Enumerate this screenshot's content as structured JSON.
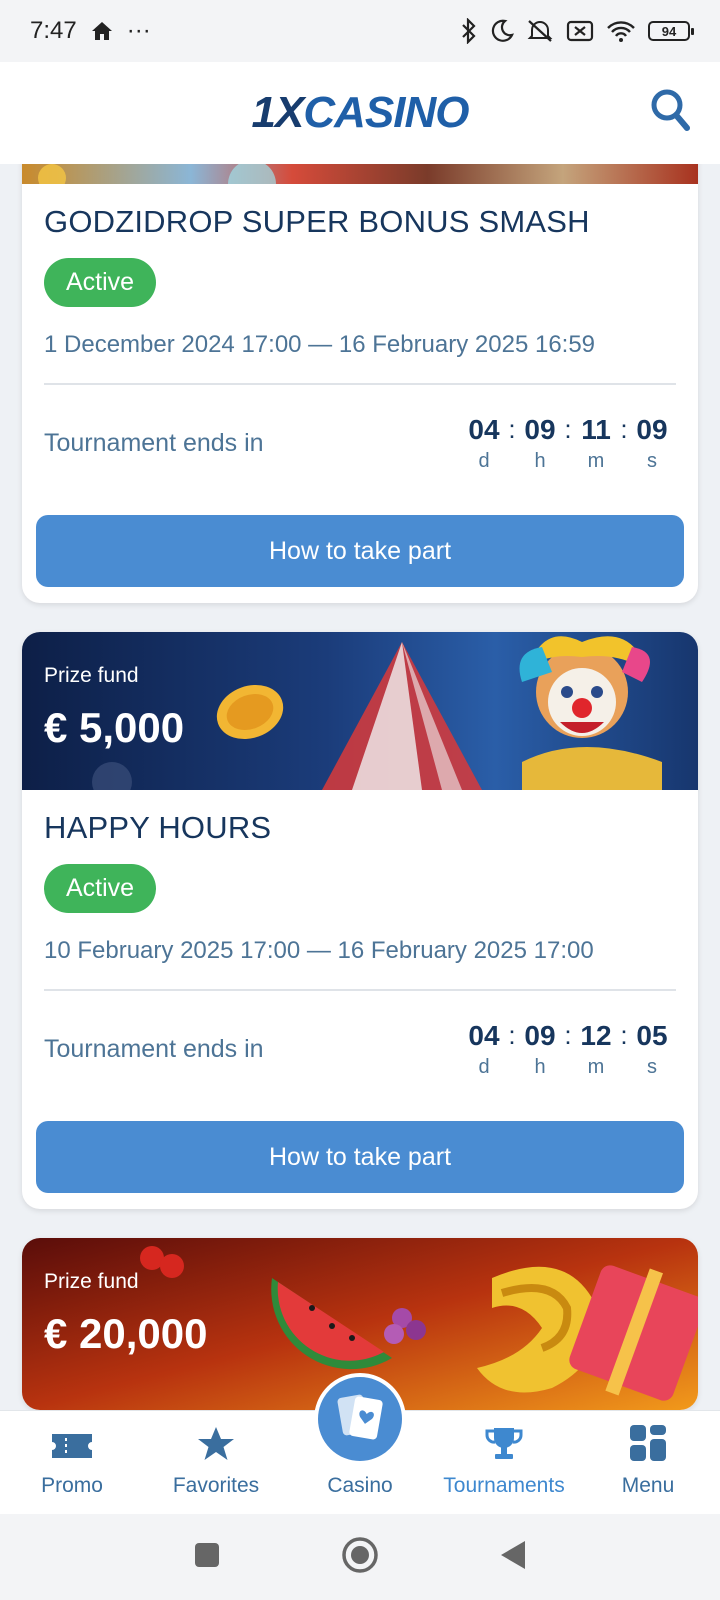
{
  "status_bar": {
    "time": "7:47",
    "more": "···",
    "battery": "94"
  },
  "header": {
    "logo_a": "1X",
    "logo_b": "CASINO"
  },
  "tournaments": [
    {
      "title": "GODZIDROP SUPER BONUS SMASH",
      "status": "Active",
      "dates": "1 December 2024 17:00 — 16 February 2025 16:59",
      "ends_label": "Tournament ends in",
      "timer": {
        "d": "04",
        "h": "09",
        "m": "11",
        "s": "09"
      },
      "button": "How to take part"
    },
    {
      "prize_label": "Prize fund",
      "prize_value": "€ 5,000",
      "title": "HAPPY HOURS",
      "status": "Active",
      "dates": "10 February 2025 17:00 — 16 February 2025 17:00",
      "ends_label": "Tournament ends in",
      "timer": {
        "d": "04",
        "h": "09",
        "m": "12",
        "s": "05"
      },
      "button": "How to take part"
    },
    {
      "prize_label": "Prize fund",
      "prize_value": "€ 20,000"
    }
  ],
  "timer_units": {
    "d": "d",
    "h": "h",
    "m": "m",
    "s": "s"
  },
  "timer_sep": ":",
  "nav": {
    "promo": "Promo",
    "favorites": "Favorites",
    "casino": "Casino",
    "tournaments": "Tournaments",
    "menu": "Menu"
  },
  "colors": {
    "accent": "#4a8cd2",
    "active_badge": "#3fb45a",
    "title_text": "#17365d",
    "secondary_text": "#4d7496"
  }
}
